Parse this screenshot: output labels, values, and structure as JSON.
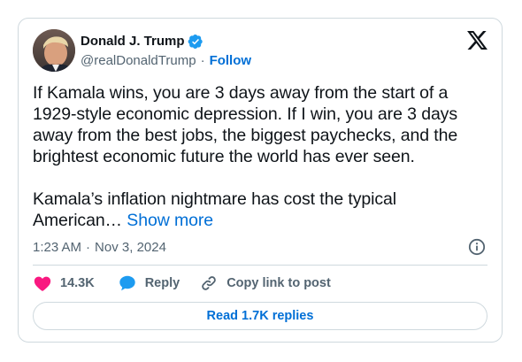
{
  "author": {
    "display_name": "Donald J. Trump",
    "handle": "@realDonaldTrump",
    "separator": "·",
    "follow_label": "Follow",
    "verified": true
  },
  "tweet": {
    "text": "If Kamala wins, you are 3 days away from the start of a 1929-style economic depression. If I win, you are 3 days away from the best jobs, the biggest paychecks, and the brightest economic future the world has ever seen.\n\nKamala’s inflation nightmare has cost the typical American…",
    "show_more_label": "Show more"
  },
  "meta": {
    "time": "1:23 AM",
    "separator": "·",
    "date": "Nov 3, 2024"
  },
  "actions": {
    "like_count": "14.3K",
    "reply_label": "Reply",
    "copy_link_label": "Copy link to post"
  },
  "read_replies_label": "Read 1.7K replies",
  "colors": {
    "accent": "#006fd6",
    "verified": "#1d9bf0",
    "like": "#f91880",
    "reply": "#1d9bf0",
    "secondary_text": "#536471",
    "border": "#cfd9de"
  },
  "icons": {
    "verified": "verified-badge-icon",
    "x_logo": "x-logo-icon",
    "info": "info-icon",
    "like": "heart-icon",
    "reply": "speech-bubble-icon",
    "copy_link": "link-icon"
  }
}
